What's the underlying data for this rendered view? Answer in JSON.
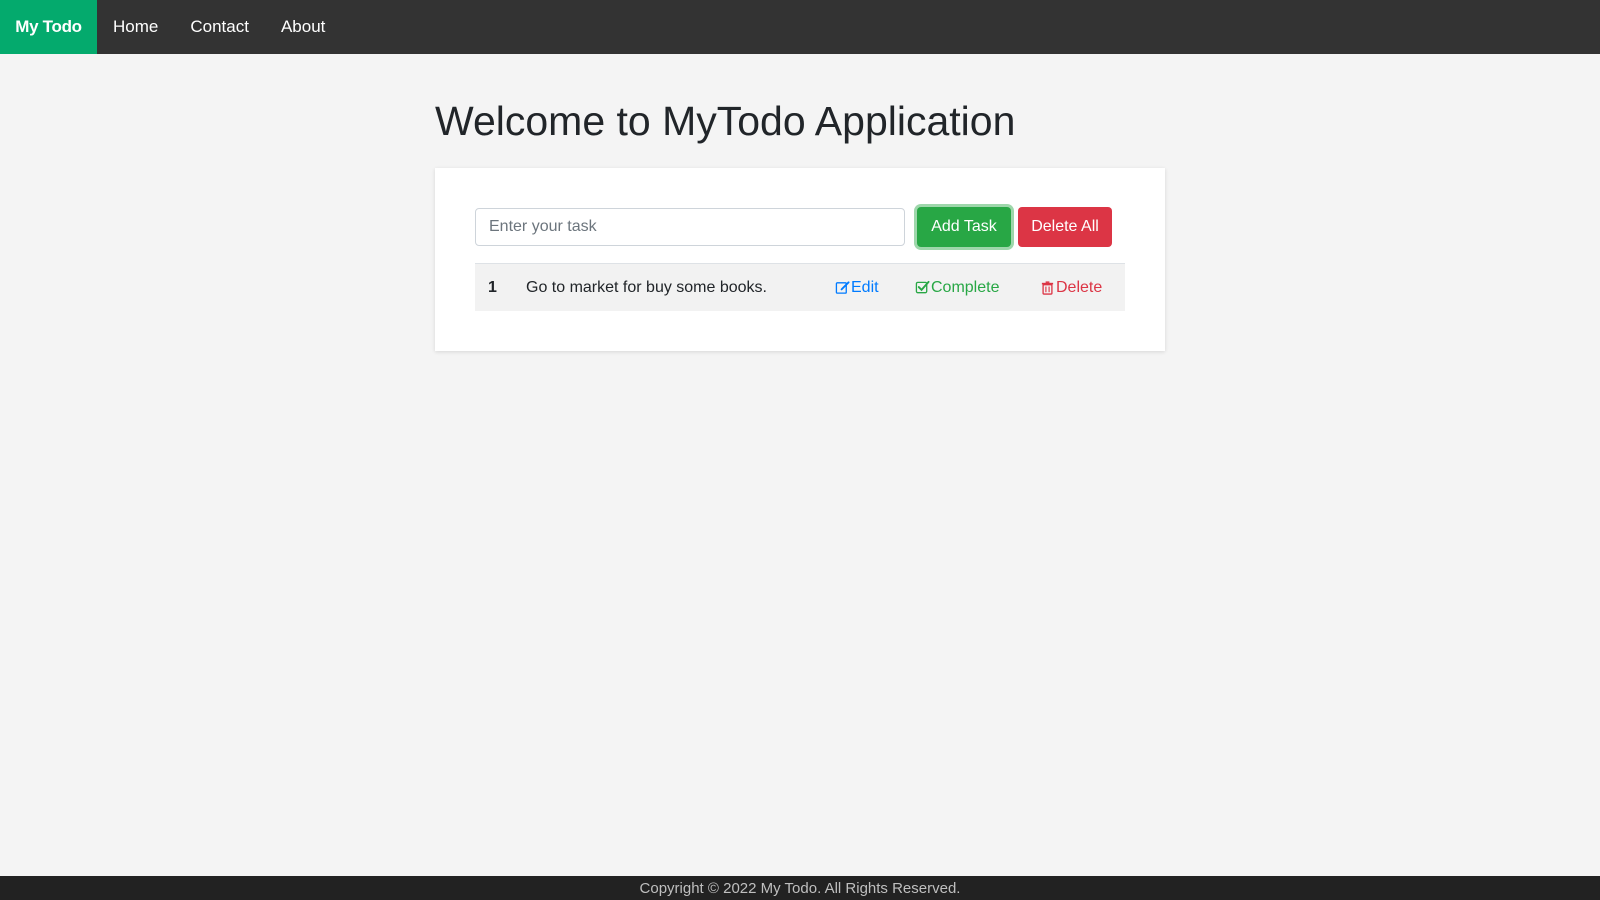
{
  "navbar": {
    "brand": "My Todo",
    "links": [
      "Home",
      "Contact",
      "About"
    ],
    "brand_color": "#04aa6d",
    "background": "#333333"
  },
  "main": {
    "title": "Welcome to MyTodo Application",
    "input": {
      "placeholder": "Enter your task",
      "value": ""
    },
    "add_button": "Add Task",
    "delete_all_button": "Delete All",
    "tasks": [
      {
        "number": "1",
        "text": "Go to market for buy some books.",
        "edit_label": "Edit",
        "complete_label": "Complete",
        "delete_label": "Delete",
        "icons": [
          "edit-icon",
          "check-square-icon",
          "trash-icon"
        ]
      }
    ]
  },
  "colors": {
    "success": "#28a745",
    "danger": "#dc3545",
    "primary": "#007bff"
  },
  "footer": {
    "text": "Copyright © 2022 My Todo. All Rights Reserved."
  }
}
